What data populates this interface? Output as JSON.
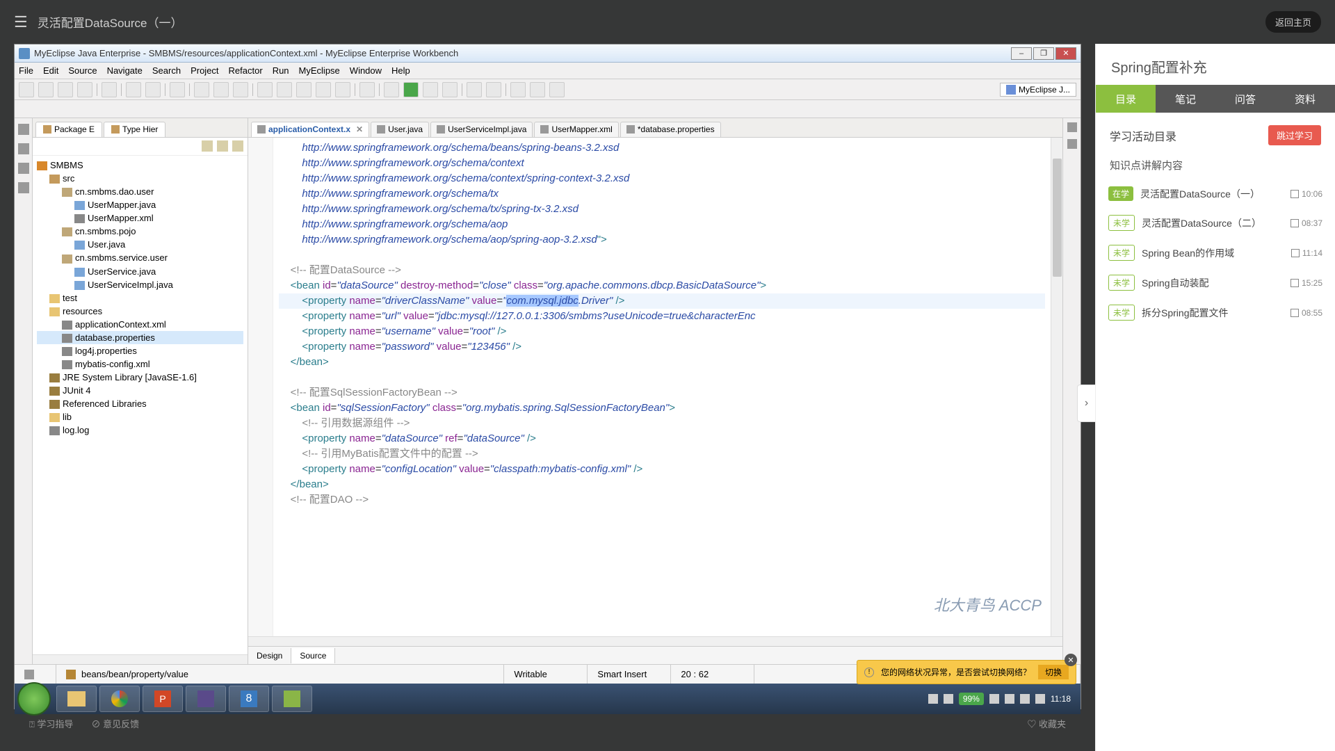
{
  "top": {
    "title": "灵活配置DataSource（一）",
    "back": "返回主页"
  },
  "window": {
    "title": "MyEclipse Java Enterprise - SMBMS/resources/applicationContext.xml - MyEclipse Enterprise Workbench",
    "perspective": "MyEclipse J..."
  },
  "menus": [
    "File",
    "Edit",
    "Source",
    "Navigate",
    "Search",
    "Project",
    "Refactor",
    "Run",
    "MyEclipse",
    "Window",
    "Help"
  ],
  "explorer": {
    "tab1": "Package E",
    "tab2": "Type Hier",
    "tree": [
      {
        "lvl": 0,
        "icon": "ic-proj",
        "label": "SMBMS"
      },
      {
        "lvl": 1,
        "icon": "ic-src",
        "label": "src"
      },
      {
        "lvl": 2,
        "icon": "ic-pkg",
        "label": "cn.smbms.dao.user"
      },
      {
        "lvl": 3,
        "icon": "ic-java",
        "label": "UserMapper.java"
      },
      {
        "lvl": 3,
        "icon": "ic-xml",
        "label": "UserMapper.xml"
      },
      {
        "lvl": 2,
        "icon": "ic-pkg",
        "label": "cn.smbms.pojo"
      },
      {
        "lvl": 3,
        "icon": "ic-java",
        "label": "User.java"
      },
      {
        "lvl": 2,
        "icon": "ic-pkg",
        "label": "cn.smbms.service.user"
      },
      {
        "lvl": 3,
        "icon": "ic-java",
        "label": "UserService.java"
      },
      {
        "lvl": 3,
        "icon": "ic-java",
        "label": "UserServiceImpl.java"
      },
      {
        "lvl": 1,
        "icon": "ic-fold",
        "label": "test"
      },
      {
        "lvl": 1,
        "icon": "ic-fold",
        "label": "resources"
      },
      {
        "lvl": 2,
        "icon": "ic-xml",
        "label": "applicationContext.xml"
      },
      {
        "lvl": 2,
        "icon": "ic-prop",
        "label": "database.properties",
        "sel": true
      },
      {
        "lvl": 2,
        "icon": "ic-prop",
        "label": "log4j.properties"
      },
      {
        "lvl": 2,
        "icon": "ic-xml",
        "label": "mybatis-config.xml"
      },
      {
        "lvl": 1,
        "icon": "ic-lib",
        "label": "JRE System Library [JavaSE-1.6]"
      },
      {
        "lvl": 1,
        "icon": "ic-lib",
        "label": "JUnit 4"
      },
      {
        "lvl": 1,
        "icon": "ic-lib",
        "label": "Referenced Libraries"
      },
      {
        "lvl": 1,
        "icon": "ic-fold",
        "label": "lib"
      },
      {
        "lvl": 1,
        "icon": "ic-file",
        "label": "log.log"
      }
    ]
  },
  "editor": {
    "tabs": [
      {
        "label": "applicationContext.x",
        "active": true,
        "icon": "ic-xml"
      },
      {
        "label": "User.java",
        "icon": "ic-java"
      },
      {
        "label": "UserServiceImpl.java",
        "icon": "ic-java"
      },
      {
        "label": "UserMapper.xml",
        "icon": "ic-xml"
      },
      {
        "label": "*database.properties",
        "icon": "ic-prop"
      }
    ],
    "urls": [
      "http://www.springframework.org/schema/beans/spring-beans-3.2.xsd",
      "http://www.springframework.org/schema/context",
      "http://www.springframework.org/schema/context/spring-context-3.2.xsd",
      "http://www.springframework.org/schema/tx",
      "http://www.springframework.org/schema/tx/spring-tx-3.2.xsd",
      "http://www.springframework.org/schema/aop",
      "http://www.springframework.org/schema/aop/spring-aop-3.2.xsd"
    ],
    "cmt1": "<!-- 配置DataSource -->",
    "bean1": "dataSource",
    "destroy": "close",
    "class1": "org.apache.commons.dbcp.BasicDataSource",
    "p1n": "driverClassName",
    "p1v_sel": "com.mysql.jdbc",
    "p1v_rest": ".Driver",
    "p2n": "url",
    "p2v": "jdbc:mysql://127.0.0.1:3306/smbms?useUnicode=true&characterEnc",
    "p3n": "username",
    "p3v": "root",
    "p4n": "password",
    "p4v": "123456",
    "cmt2": "<!-- 配置SqlSessionFactoryBean -->",
    "bean2": "sqlSessionFactory",
    "class2": "org.mybatis.spring.SqlSessionFactoryBean",
    "cmt3": "<!-- 引用数据源组件 -->",
    "p5n": "dataSource",
    "p5ref": "dataSource",
    "cmt4": "<!-- 引用MyBatis配置文件中的配置 -->",
    "p6n": "configLocation",
    "p6v": "classpath:mybatis-config.xml",
    "cmt5": "<!-- 配置DAO -->",
    "bot_tabs": {
      "design": "Design",
      "source": "Source"
    },
    "status": {
      "path": "beans/bean/property/value",
      "mode": "Writable",
      "insert": "Smart Insert",
      "pos": "20 : 62"
    }
  },
  "taskbar": {
    "time": "11:18",
    "notif": "您的网络状况异常，是否尝试切换网络？",
    "switch": "切换",
    "watermark": "北大青鸟 ACCP"
  },
  "sidebar": {
    "title": "Spring配置补充",
    "tabs": [
      "目录",
      "笔记",
      "问答",
      "资料"
    ],
    "activity": "学习活动目录",
    "skip": "跳过学习",
    "sub": "知识点讲解内容",
    "lessons": [
      {
        "badge": "在学",
        "type": "live",
        "label": "灵活配置DataSource（一）",
        "dur": "10:06"
      },
      {
        "badge": "未学",
        "type": "todo",
        "label": "灵活配置DataSource（二）",
        "dur": "08:37"
      },
      {
        "badge": "未学",
        "type": "todo",
        "label": "Spring Bean的作用域",
        "dur": "11:14"
      },
      {
        "badge": "未学",
        "type": "todo",
        "label": "Spring自动装配",
        "dur": "15:25"
      },
      {
        "badge": "未学",
        "type": "todo",
        "label": "拆分Spring配置文件",
        "dur": "08:55"
      }
    ]
  },
  "bottom": {
    "guide": "学习指导",
    "feedback": "意见反馈",
    "fav": "收藏夹"
  }
}
